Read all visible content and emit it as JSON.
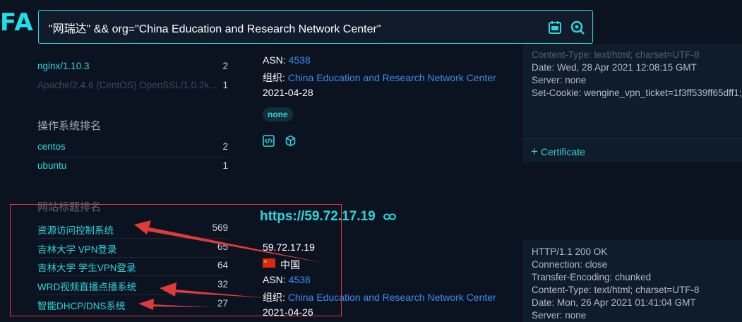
{
  "logo": "FA",
  "search": {
    "value": "\"网瑞达\" && org=\"China Education and Research Network Center\""
  },
  "left_panel": {
    "server_items": [
      {
        "name": "nginx/1.10.3",
        "count": "2"
      },
      {
        "name": "Apache/2.4.6 (CentOS) OpenSSL/1.0.2k...",
        "count": "1"
      }
    ],
    "os_title": "操作系统排名",
    "os_items": [
      {
        "name": "centos",
        "count": "2"
      },
      {
        "name": "ubuntu",
        "count": "1"
      }
    ],
    "title_rank_title": "网站标题排名",
    "title_items": [
      {
        "name": "资源访问控制系统",
        "count": "569"
      },
      {
        "name": "吉林大学 VPN登录",
        "count": "65"
      },
      {
        "name": "吉林大学 学生VPN登录",
        "count": "64"
      },
      {
        "name": "WRD视频直播点播系统",
        "count": "32"
      },
      {
        "name": "智能DHCP/DNS系统",
        "count": "27"
      }
    ]
  },
  "result1": {
    "asn_label": "ASN:",
    "asn": "4538",
    "org_label": "组织:",
    "org": "China Education and Research Network Center",
    "date": "2021-04-28",
    "badge": "none",
    "header_lines": [
      "Content-Type: text/html; charset=UTF-8",
      "Date: Wed, 28 Apr 2021 12:08:15 GMT",
      "Server: none",
      "Set-Cookie: wengine_vpn_ticket=1f3ff539ff65dff1;"
    ],
    "certificate": "Certificate"
  },
  "result2": {
    "host": "https://59.72.17.19",
    "ip": "59.72.17.19",
    "country": "中国",
    "asn_label": "ASN:",
    "asn": "4538",
    "org_label": "组织:",
    "org": "China Education and Research Network Center",
    "date": "2021-04-26",
    "header_lines": [
      "HTTP/1.1 200 OK",
      "Connection: close",
      "Transfer-Encoding: chunked",
      "Content-Type: text/html; charset=UTF-8",
      "Date: Mon, 26 Apr 2021 01:41:04 GMT",
      "Server: none"
    ]
  },
  "colors": {
    "accent": "#2bd6db",
    "link": "#3b8cf0",
    "annotation": "#e03a3a",
    "background": "#0b1321"
  }
}
